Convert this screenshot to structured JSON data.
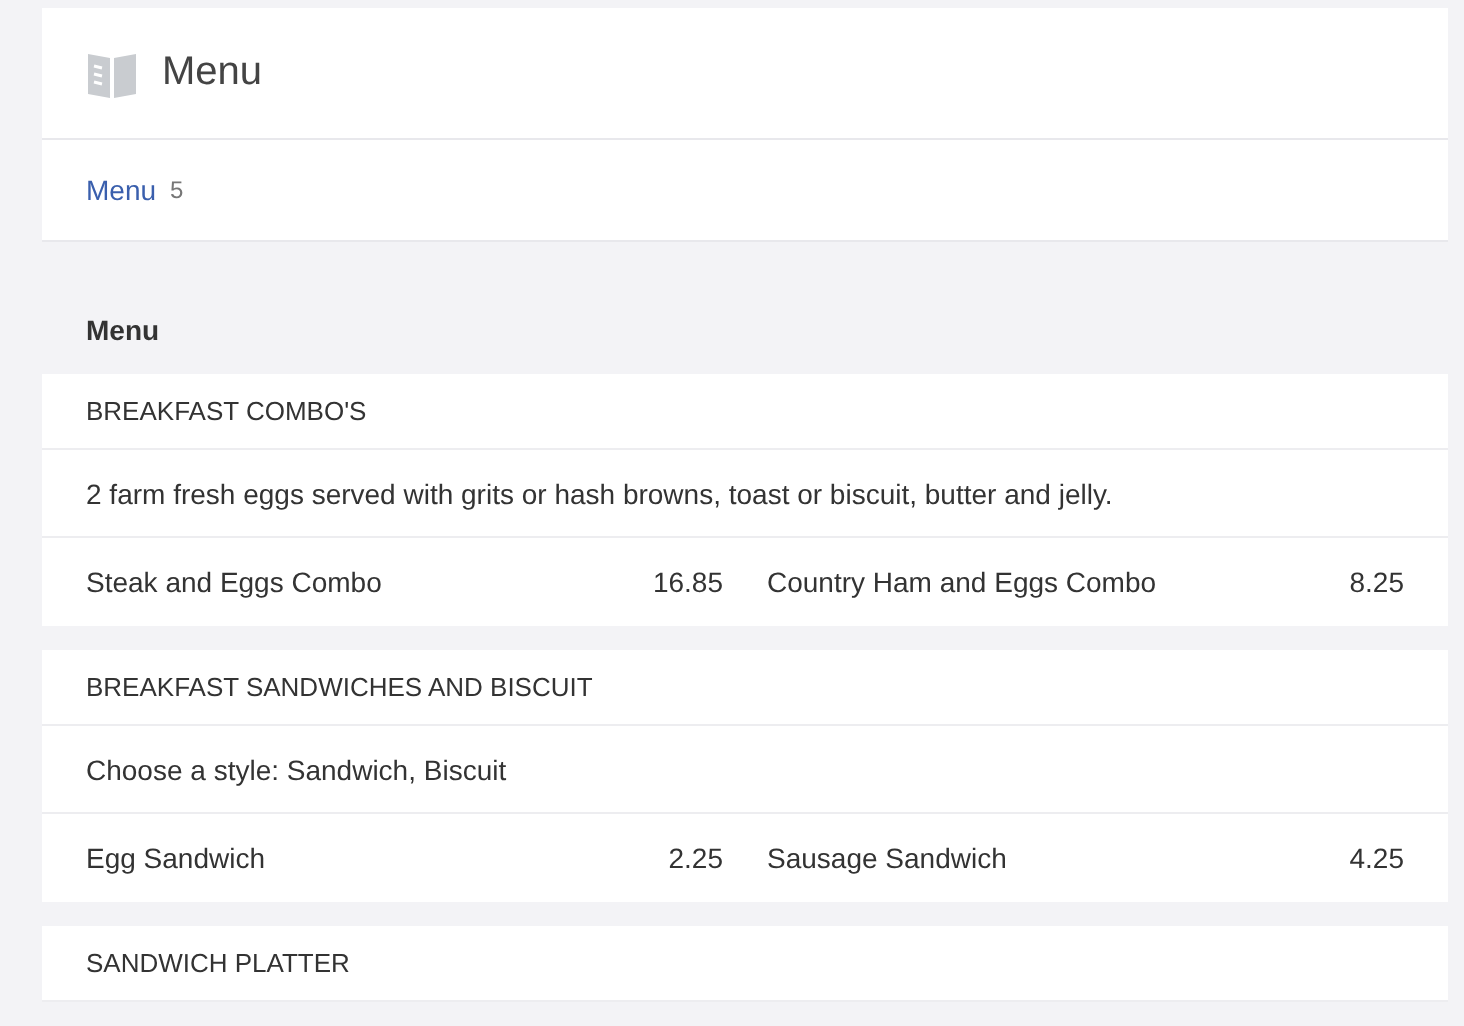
{
  "header": {
    "title": "Menu"
  },
  "tabs": [
    {
      "label": "Menu",
      "count": "5",
      "selected": true
    }
  ],
  "menu_title": "Menu",
  "sections": [
    {
      "name": "BREAKFAST COMBO'S",
      "description": "2 farm fresh eggs served with grits or hash browns, toast or biscuit, butter and jelly.",
      "items": [
        {
          "name": "Steak and Eggs Combo",
          "price": "16.85"
        },
        {
          "name": "Country Ham and Eggs Combo",
          "price": "8.25"
        }
      ]
    },
    {
      "name": "BREAKFAST SANDWICHES AND BISCUIT",
      "description": "Choose a style: Sandwich, Biscuit",
      "items": [
        {
          "name": "Egg Sandwich",
          "price": "2.25"
        },
        {
          "name": "Sausage Sandwich",
          "price": "4.25"
        }
      ]
    },
    {
      "name": "SANDWICH PLATTER"
    }
  ]
}
